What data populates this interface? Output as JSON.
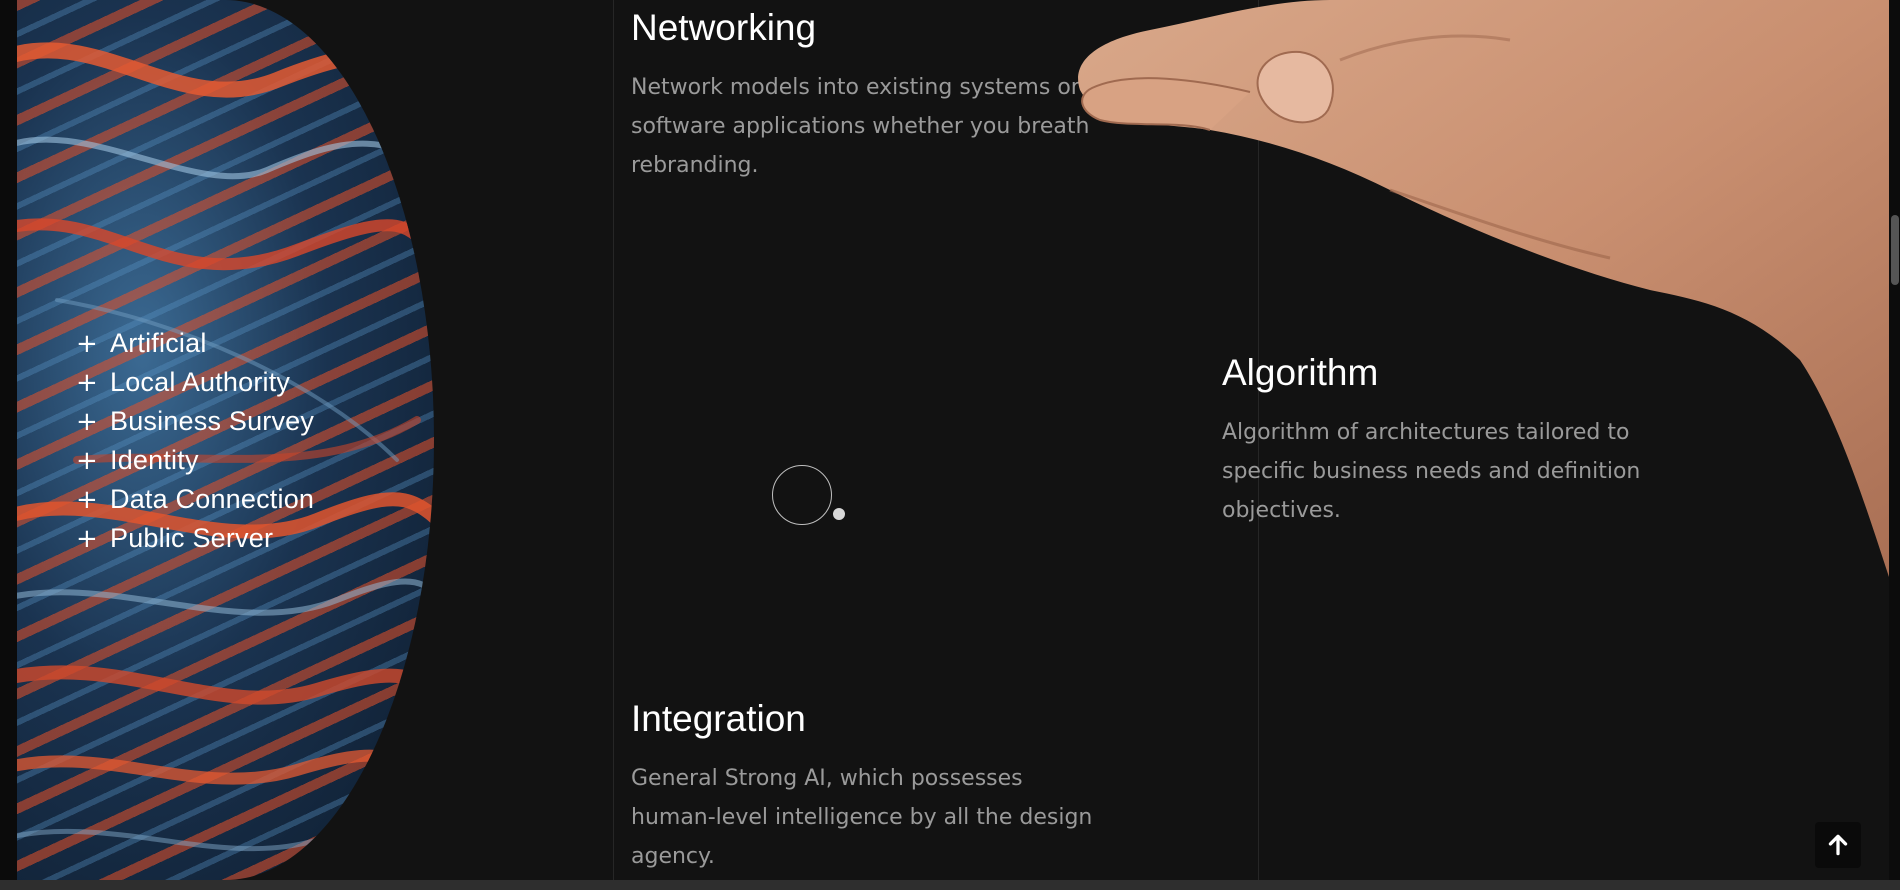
{
  "menu": {
    "items": [
      {
        "icon": "plus-icon",
        "label": "Artificial"
      },
      {
        "icon": "plus-icon",
        "label": "Local Authority"
      },
      {
        "icon": "plus-icon",
        "label": "Business Survey"
      },
      {
        "icon": "plus-icon",
        "label": "Identity"
      },
      {
        "icon": "plus-icon",
        "label": "Data Connection"
      },
      {
        "icon": "plus-icon",
        "label": "Public Server"
      }
    ]
  },
  "services": [
    {
      "title": "Networking",
      "description": "Network models into existing systems or software applications whether you breath rebranding."
    },
    {
      "title": "Algorithm",
      "description": "Algorithm of architectures tailored to specific business needs and definition objectives."
    },
    {
      "title": "Integration",
      "description": "General Strong AI, which possesses human-level intelligence by all the design agency."
    }
  ],
  "back_to_top": {
    "icon": "arrow-up-icon"
  },
  "colors": {
    "background": "#121212",
    "heading": "#ffffff",
    "body_text": "#9a9a9a",
    "art_orange": "#e25530",
    "art_blue": "#2b5478"
  }
}
